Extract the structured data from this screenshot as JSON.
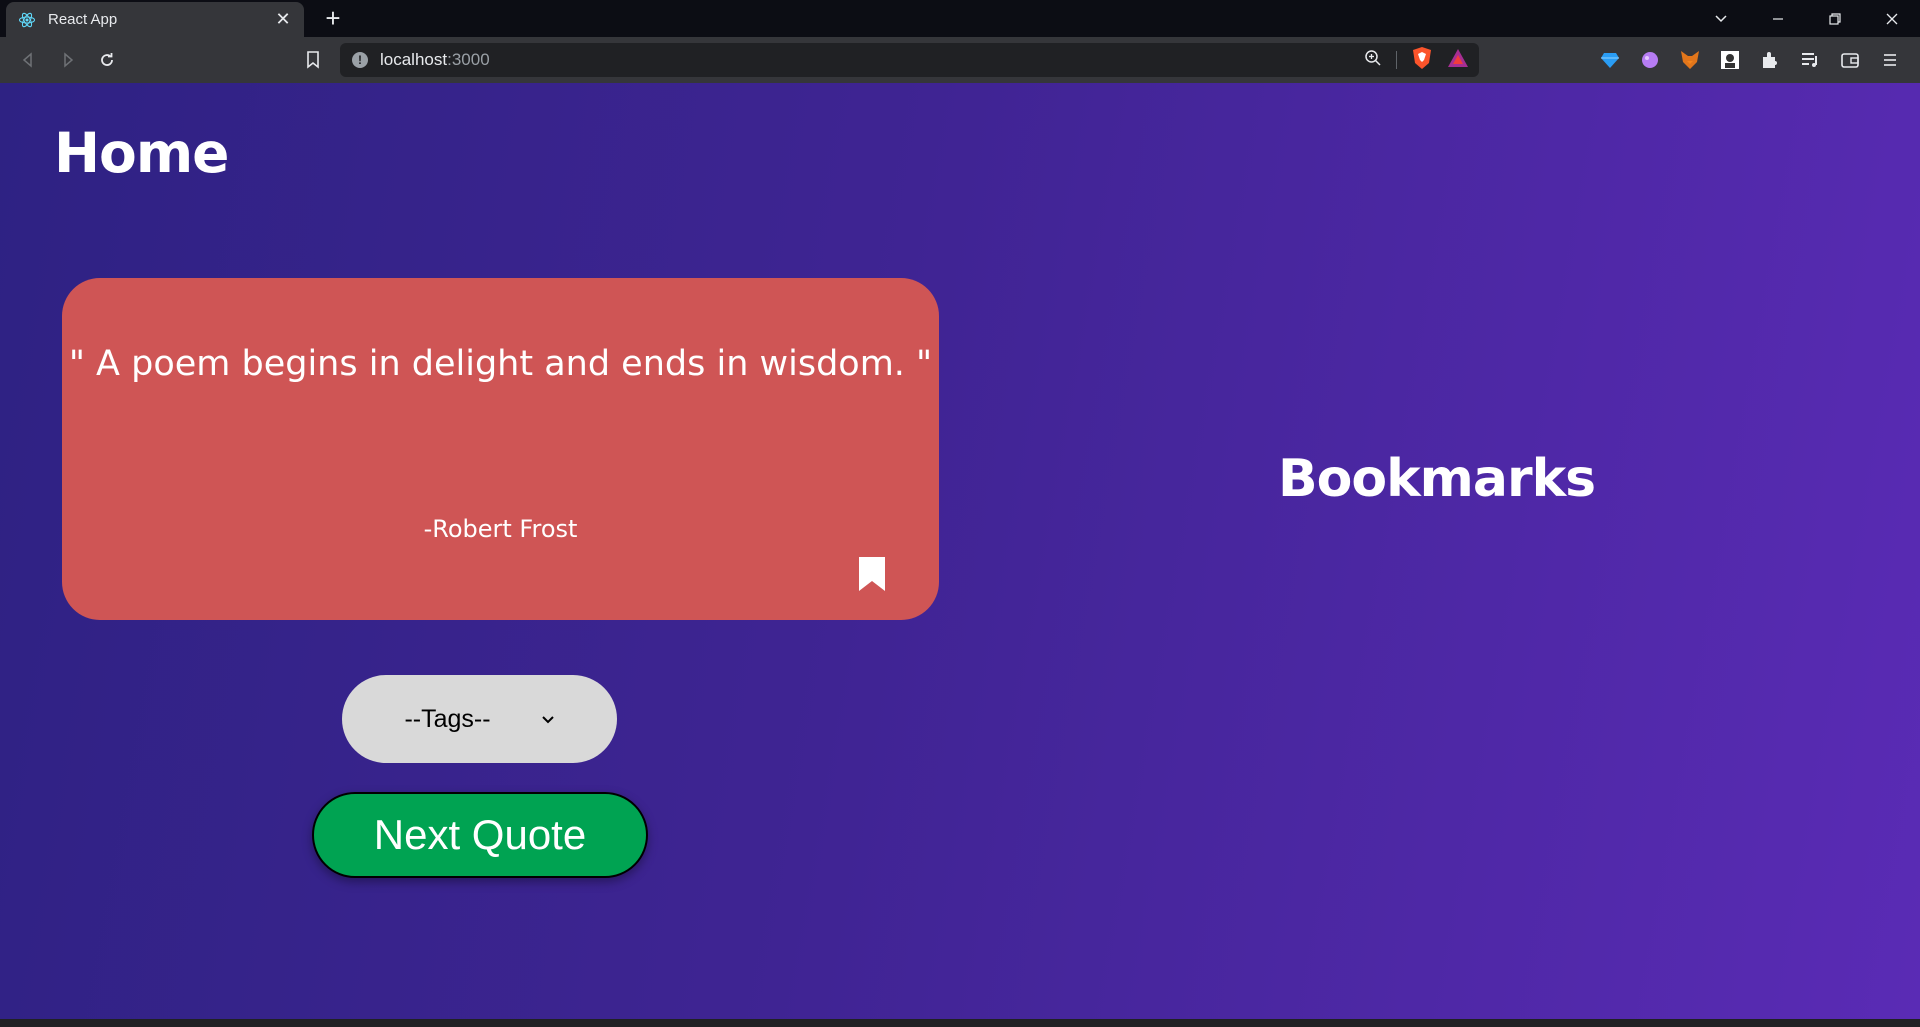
{
  "browser": {
    "tab": {
      "title": "React App",
      "favicon": "react-icon"
    },
    "address": {
      "host": "localhost",
      "port": ":3000"
    },
    "extensions": [
      "diamond-icon",
      "paint-icon",
      "fox-icon",
      "avatar-icon",
      "puzzle-icon",
      "playlist-icon",
      "wallet-icon",
      "menu-icon"
    ]
  },
  "page": {
    "title": "Home",
    "quote": {
      "text": "\" A poem begins in delight and ends in wisdom. \"",
      "author": "-Robert Frost"
    },
    "tags_select": {
      "selected": "--Tags--"
    },
    "next_button": "Next Quote",
    "bookmarks_title": "Bookmarks"
  },
  "colors": {
    "card": "#cf5555",
    "button": "#00a352",
    "gradient_start": "#2e2283",
    "gradient_end": "#5a2bb5"
  }
}
